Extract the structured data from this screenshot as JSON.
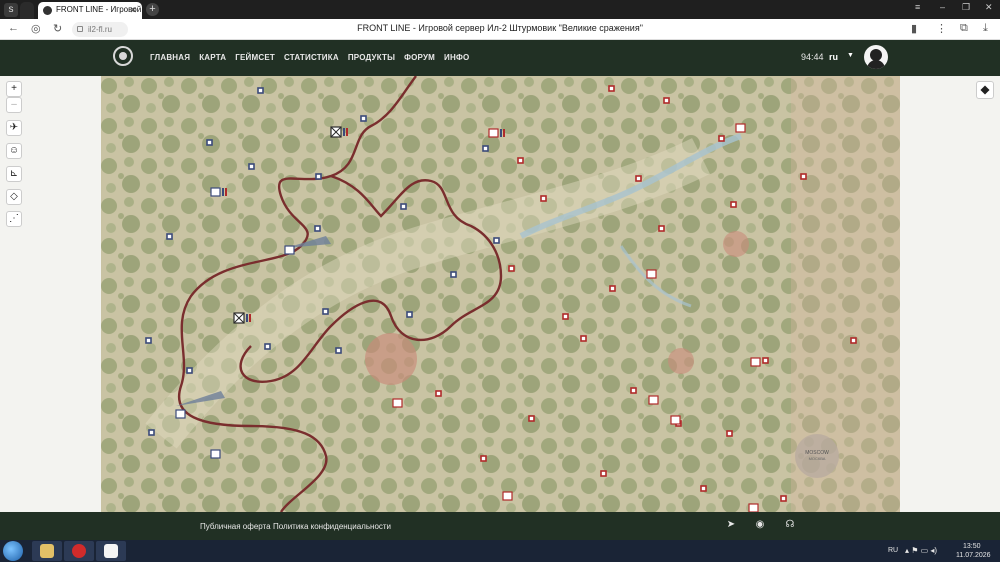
{
  "browser": {
    "tabs": [
      {
        "label": ""
      },
      {
        "label": "FRONT LINE - Игровой"
      }
    ],
    "url": "il2-fl.ru",
    "page_title": "FRONT LINE - Игровой сервер Ил-2 Штурмовик \"Великие сражения\""
  },
  "header": {
    "menu": [
      "ГЛАВНАЯ",
      "КАРТА",
      "ГЕЙМСЕТ",
      "СТАТИСТИКА",
      "ПРОДУКТЫ",
      "ФОРУМ",
      "ИНФО"
    ],
    "time": "94:44",
    "language": "ru"
  },
  "map": {
    "city_label": "MOSCOW",
    "city_label_ru": "МОСКВА",
    "colors": {
      "terrain": "#c9c3a4",
      "forest": "#8e9a6a",
      "front_line": "#7a2e2e",
      "allied": "#3b4a7a",
      "axis": "#b02a2a",
      "water": "#a8c3d0"
    }
  },
  "footer": {
    "links": [
      "Публичная оферта",
      "Политика конфиденциальности"
    ]
  },
  "taskbar": {
    "lang": "RU",
    "time": "13:50",
    "date": "11.07.2026"
  }
}
